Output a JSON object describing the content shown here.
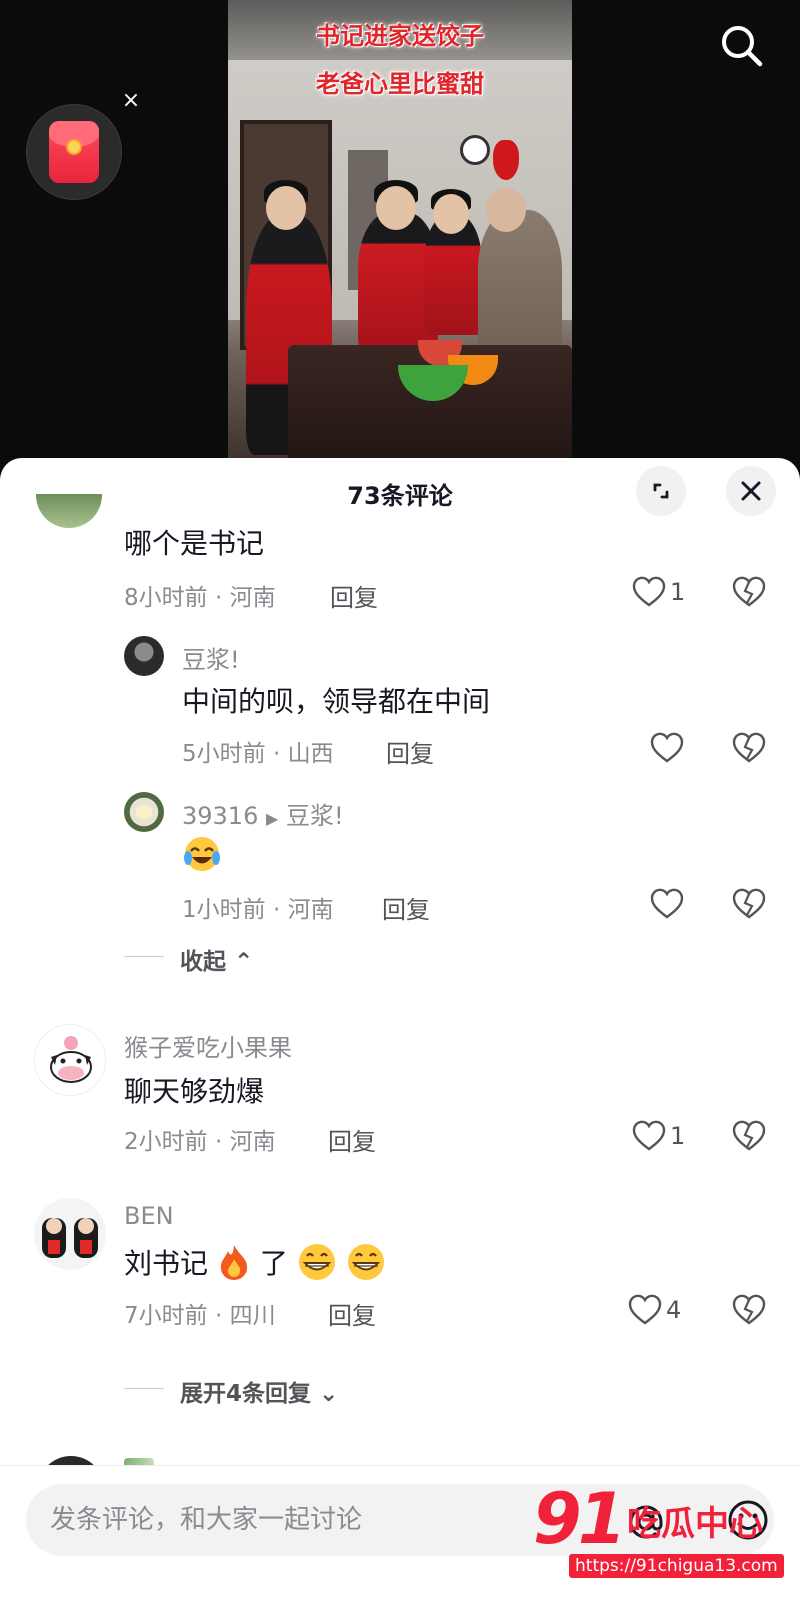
{
  "video": {
    "caption_line1": "书记进家送饺子",
    "caption_line2": "老爸心里比蜜甜"
  },
  "overlay": {
    "search_icon": "search-icon",
    "redpacket_icon": "red-envelope-icon",
    "close_glyph": "×"
  },
  "sheet": {
    "title": "73条评论",
    "expand_icon": "expand-icon",
    "close_icon": "close-icon"
  },
  "comments": [
    {
      "text": "哪个是书记",
      "time": "8小时前",
      "location": "河南",
      "reply_label": "回复",
      "likes": "1"
    },
    {
      "name": "豆浆!",
      "text": "中间的呗，领导都在中间",
      "time": "5小时前",
      "location": "山西",
      "reply_label": "回复",
      "likes": ""
    },
    {
      "name": "39316",
      "reply_to": "豆浆!",
      "text": "",
      "emoji": "laughing-crying-emoji",
      "time": "1小时前",
      "location": "河南",
      "reply_label": "回复",
      "likes": ""
    },
    {
      "name": "猴子爱吃小果果",
      "text": "聊天够劲爆",
      "time": "2小时前",
      "location": "河南",
      "reply_label": "回复",
      "likes": "1"
    },
    {
      "name": "BEN",
      "text": "刘书记",
      "text_suffix": "了",
      "emojis": [
        "fire-emoji",
        "grinning-emoji",
        "grinning-emoji"
      ],
      "time": "7小时前",
      "location": "四川",
      "reply_label": "回复",
      "likes": "4"
    }
  ],
  "collapse_label": "收起",
  "expand_replies_label": "展开4条回复",
  "meta_separator": "·",
  "input": {
    "placeholder": "发条评论，和大家一起讨论",
    "at_icon": "at-icon",
    "emoji_icon": "emoji-icon"
  },
  "watermark": {
    "number": "91",
    "brand": "吃瓜中心",
    "url": "https://91chigua13.com"
  },
  "colors": {
    "caption_red": "#e0262b",
    "watermark_red": "#f2213a",
    "meta_gray": "#8a8b91"
  }
}
